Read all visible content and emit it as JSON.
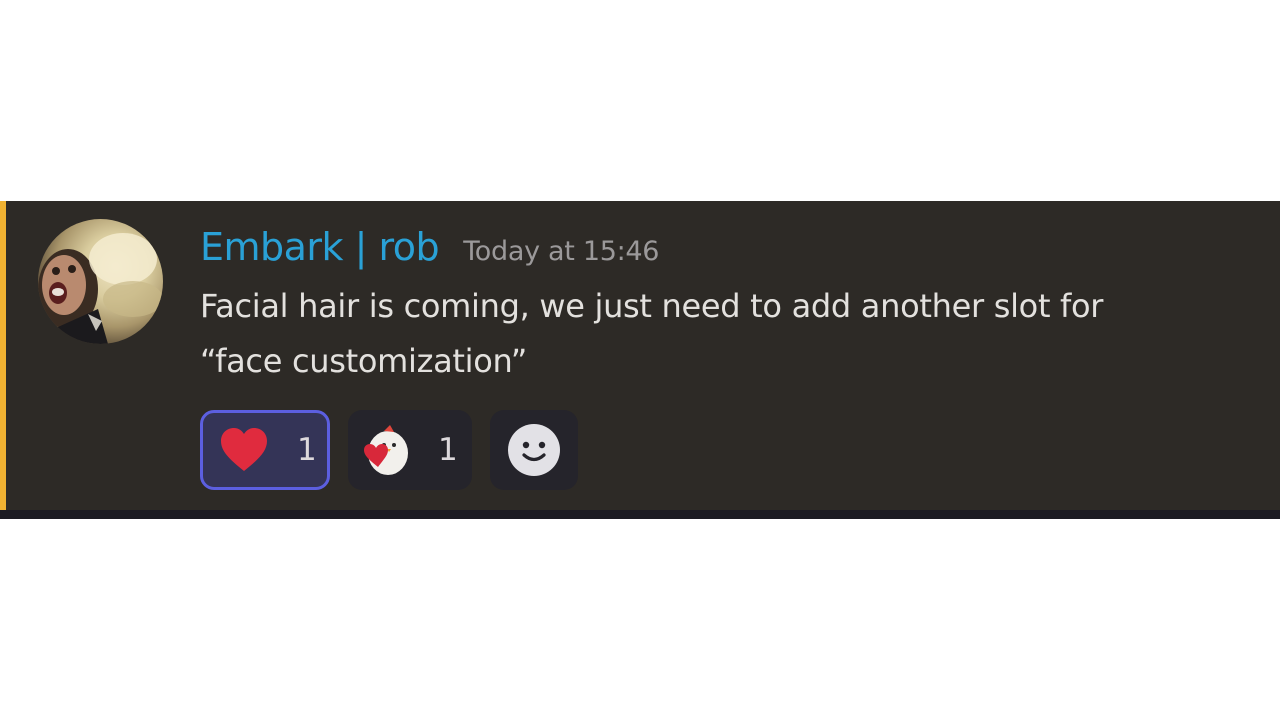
{
  "colors": {
    "message_background": "#2d2a26",
    "highlight_bar": "#f0b232",
    "username": "#2aa1d6",
    "timestamp": "#9b999a",
    "body_text": "#e3e1de",
    "reaction_active_border": "#5c5fe0"
  },
  "message": {
    "author": "Embark | rob",
    "timestamp": "Today at 15:46",
    "content_lines": [
      "Facial hair is coming, we just need to add another slot for",
      "“face customization”"
    ],
    "avatar_icon": "user-avatar"
  },
  "reactions": [
    {
      "icon": "red-heart-icon",
      "count": "1",
      "reacted": true
    },
    {
      "icon": "cartoon-bird-holding-heart-icon",
      "count": "1",
      "reacted": false
    }
  ],
  "add_reaction": {
    "icon": "smiley-face-icon"
  }
}
